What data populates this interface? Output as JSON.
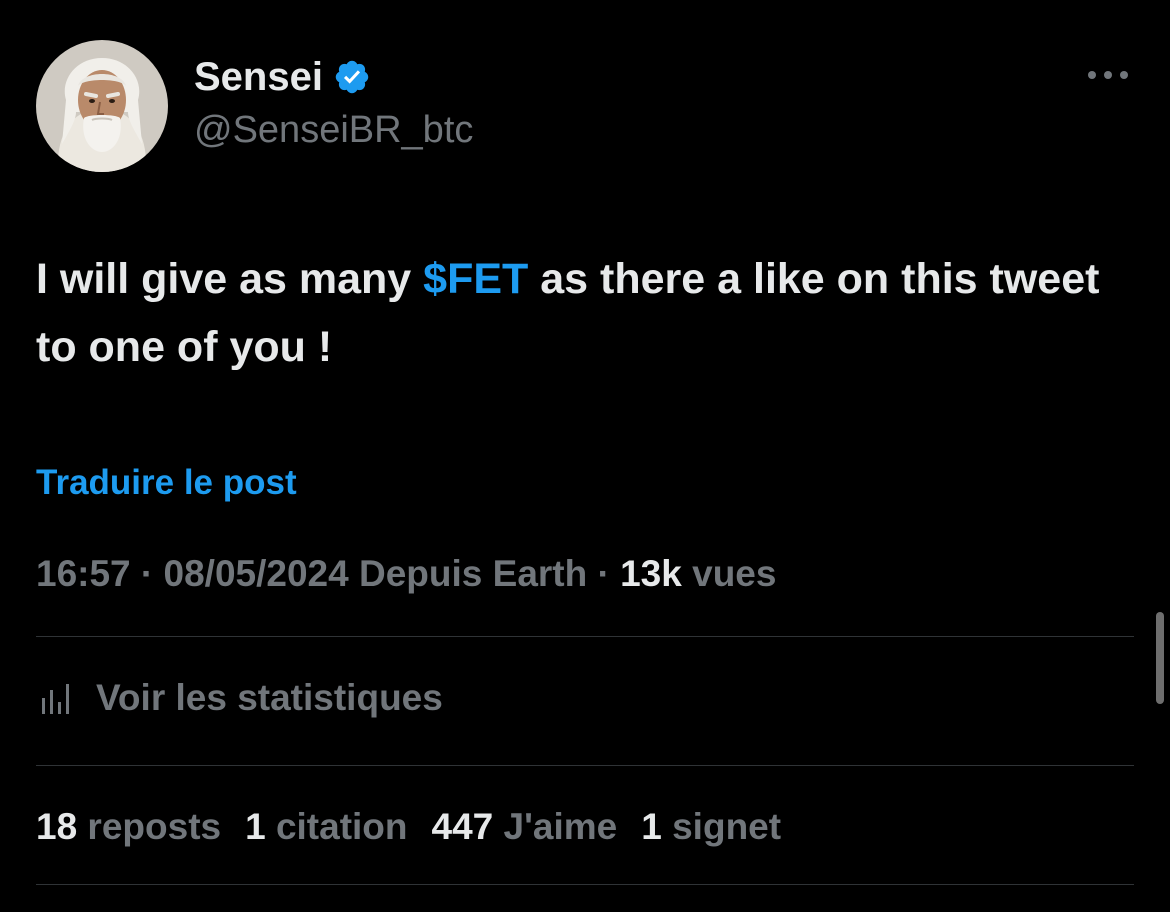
{
  "author": {
    "display_name": "Sensei",
    "handle": "@SenseiBR_btc",
    "avatar_icon": "old-sage-portrait",
    "verified_icon": "verified-badge-icon"
  },
  "tweet": {
    "text_part1": "I will give as many ",
    "cashtag": "$FET",
    "text_part2": " as there a like on this tweet to one of you !",
    "translate_label": "Traduire le post"
  },
  "meta": {
    "time": "16:57",
    "separator": " · ",
    "date": "08/05/2024",
    "source": " Depuis Earth",
    "views_count": "13k",
    "views_label": " vues"
  },
  "stats": {
    "label": "Voir les statistiques",
    "icon": "bar-chart-icon"
  },
  "engagement": {
    "reposts_count": "18",
    "reposts_label": " reposts",
    "quotes_count": "1",
    "quotes_label": " citation",
    "likes_count": "447",
    "likes_label": " J'aime",
    "bookmarks_count": "1",
    "bookmarks_label": " signet"
  },
  "colors": {
    "background": "#000000",
    "text_primary": "#e7e9ea",
    "text_secondary": "#71767b",
    "accent": "#1d9bf0",
    "divider": "#2f3336"
  }
}
